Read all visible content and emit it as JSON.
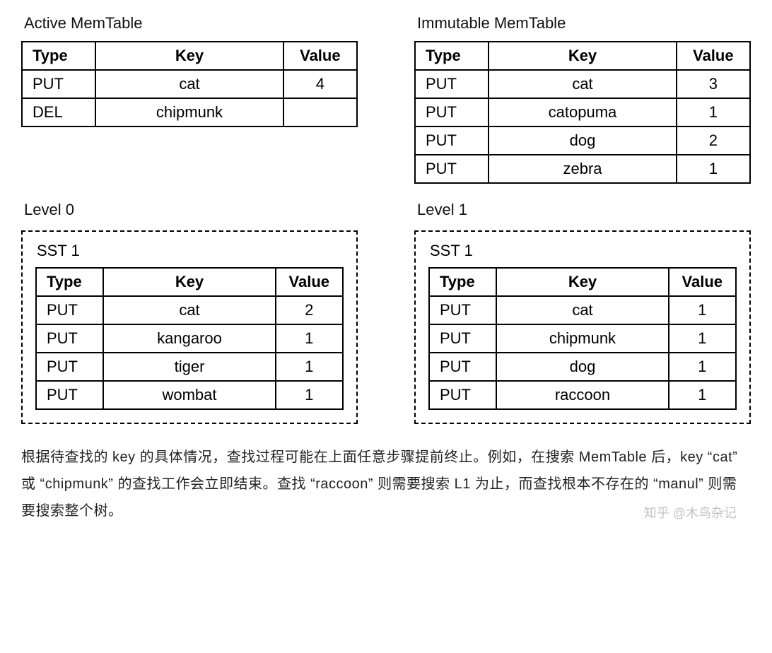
{
  "headers": {
    "type": "Type",
    "key": "Key",
    "value": "Value"
  },
  "active_memtable": {
    "title": "Active MemTable",
    "rows": [
      {
        "type": "PUT",
        "key": "cat",
        "value": "4"
      },
      {
        "type": "DEL",
        "key": "chipmunk",
        "value": ""
      }
    ]
  },
  "immutable_memtable": {
    "title": "Immutable MemTable",
    "rows": [
      {
        "type": "PUT",
        "key": "cat",
        "value": "3"
      },
      {
        "type": "PUT",
        "key": "catopuma",
        "value": "1"
      },
      {
        "type": "PUT",
        "key": "dog",
        "value": "2"
      },
      {
        "type": "PUT",
        "key": "zebra",
        "value": "1"
      }
    ]
  },
  "level0": {
    "title": "Level 0",
    "sst_label": "SST 1",
    "rows": [
      {
        "type": "PUT",
        "key": "cat",
        "value": "2"
      },
      {
        "type": "PUT",
        "key": "kangaroo",
        "value": "1"
      },
      {
        "type": "PUT",
        "key": "tiger",
        "value": "1"
      },
      {
        "type": "PUT",
        "key": "wombat",
        "value": "1"
      }
    ]
  },
  "level1": {
    "title": "Level 1",
    "sst_label": "SST 1",
    "rows": [
      {
        "type": "PUT",
        "key": "cat",
        "value": "1"
      },
      {
        "type": "PUT",
        "key": "chipmunk",
        "value": "1"
      },
      {
        "type": "PUT",
        "key": "dog",
        "value": "1"
      },
      {
        "type": "PUT",
        "key": "raccoon",
        "value": "1"
      }
    ]
  },
  "explanation": "根据待查找的 key 的具体情况，查找过程可能在上面任意步骤提前终止。例如，在搜索 MemTable 后，key “cat” 或 “chipmunk” 的查找工作会立即结束。查找 “raccoon” 则需要搜索 L1 为止，而查找根本不存在的 “manul” 则需要搜索整个树。",
  "watermark": "知乎 @木鸟杂记"
}
